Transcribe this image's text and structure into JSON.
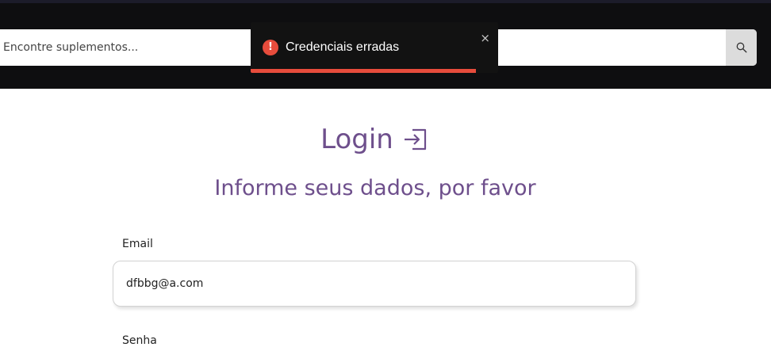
{
  "header": {
    "search": {
      "placeholder": "Encontre suplementos...",
      "button_icon": "search-icon"
    }
  },
  "toast": {
    "type": "error",
    "icon": "error-icon",
    "message": "Credenciais erradas",
    "close_label": "×",
    "progress": 0.91,
    "accent_color": "#e74c3c"
  },
  "login": {
    "title": "Login",
    "title_icon": "login-icon",
    "subtitle": "Informe seus dados, por favor",
    "email": {
      "label": "Email",
      "value": "dfbbg@a.com"
    },
    "password": {
      "label": "Senha"
    }
  },
  "colors": {
    "brand": "#6e4f8c",
    "header_bg": "#0e0e10",
    "error": "#e74c3c"
  }
}
